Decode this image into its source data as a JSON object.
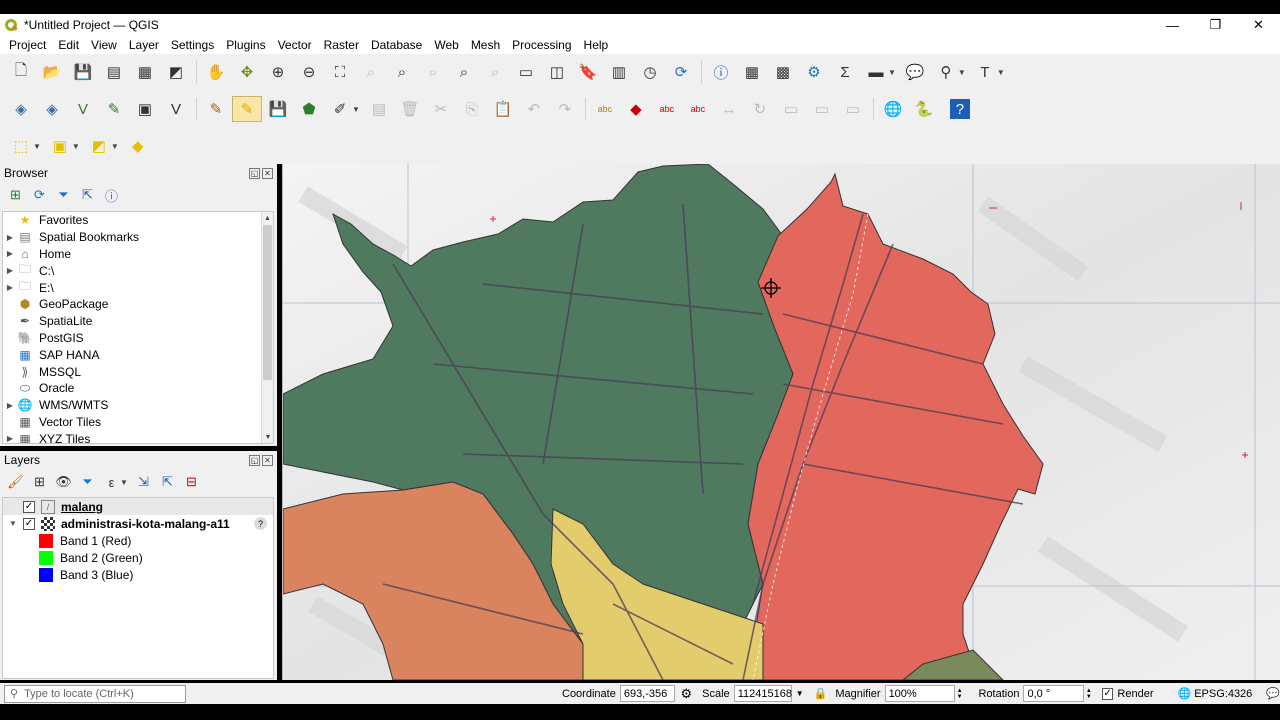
{
  "window": {
    "title": "*Untitled Project — QGIS",
    "minimize": "—",
    "restore": "❐",
    "close": "✕"
  },
  "menu": [
    "Project",
    "Edit",
    "View",
    "Layer",
    "Settings",
    "Plugins",
    "Vector",
    "Raster",
    "Database",
    "Web",
    "Mesh",
    "Processing",
    "Help"
  ],
  "browser": {
    "title": "Browser",
    "items": [
      {
        "label": "Favorites",
        "icon": "star-icon",
        "expand": false
      },
      {
        "label": "Spatial Bookmarks",
        "icon": "bookmark-icon",
        "expand": true
      },
      {
        "label": "Home",
        "icon": "home-folder-icon",
        "expand": true
      },
      {
        "label": "C:\\",
        "icon": "folder-icon",
        "expand": true
      },
      {
        "label": "E:\\",
        "icon": "folder-icon",
        "expand": true
      },
      {
        "label": "GeoPackage",
        "icon": "geopackage-icon",
        "expand": false
      },
      {
        "label": "SpatiaLite",
        "icon": "spatialite-icon",
        "expand": false
      },
      {
        "label": "PostGIS",
        "icon": "postgis-icon",
        "expand": false
      },
      {
        "label": "SAP HANA",
        "icon": "saphana-icon",
        "expand": false
      },
      {
        "label": "MSSQL",
        "icon": "mssql-icon",
        "expand": false
      },
      {
        "label": "Oracle",
        "icon": "oracle-icon",
        "expand": false
      },
      {
        "label": "WMS/WMTS",
        "icon": "globe-icon",
        "expand": true
      },
      {
        "label": "Vector Tiles",
        "icon": "grid-icon",
        "expand": false
      },
      {
        "label": "XYZ Tiles",
        "icon": "grid-icon",
        "expand": true
      }
    ]
  },
  "layers": {
    "title": "Layers",
    "items": [
      {
        "name": "malang",
        "checked": "✓"
      },
      {
        "name": "administrasi-kota-malang-a11",
        "checked": "✓"
      }
    ],
    "bands": [
      {
        "label": "Band 1 (Red)",
        "color": "#ff0000"
      },
      {
        "label": "Band 2 (Green)",
        "color": "#00ff00"
      },
      {
        "label": "Band 3 (Blue)",
        "color": "#0000ff"
      }
    ]
  },
  "status": {
    "locator_placeholder": "Type to locate (Ctrl+K)",
    "coordinate_label": "Coordinate",
    "coordinate_value": "693,-356",
    "scale_label": "Scale",
    "scale_value": "112415168",
    "magnifier_label": "Magnifier",
    "magnifier_value": "100%",
    "rotation_label": "Rotation",
    "rotation_value": "0,0 °",
    "render_label": "Render",
    "crs": "EPSG:4326"
  },
  "colors": {
    "map_green": "#4f7a5f",
    "map_red": "#e2675c",
    "map_orange": "#d9845e",
    "map_yellow": "#e2cc6c"
  }
}
